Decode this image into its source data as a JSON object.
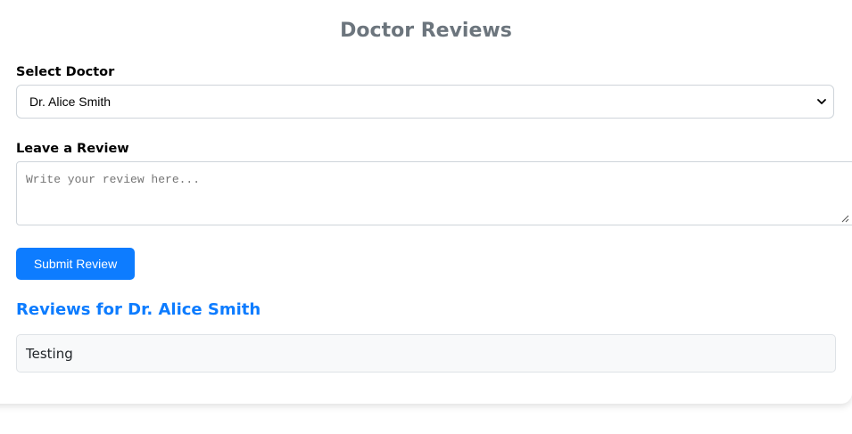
{
  "page": {
    "title": "Doctor Reviews"
  },
  "doctor_select": {
    "label": "Select Doctor",
    "selected_value": "Dr. Alice Smith"
  },
  "review_form": {
    "label": "Leave a Review",
    "placeholder": "Write your review here...",
    "value": "",
    "submit_label": "Submit Review"
  },
  "reviews": {
    "heading": "Reviews for Dr. Alice Smith",
    "items": [
      {
        "text": "Testing"
      }
    ]
  },
  "colors": {
    "accent": "#0d7cff",
    "title": "#6c757d",
    "review_bg": "#f8f9fa"
  },
  "icons": {
    "select_chevron": "chevron-down-icon",
    "textarea_resize": "resize-handle-icon"
  }
}
